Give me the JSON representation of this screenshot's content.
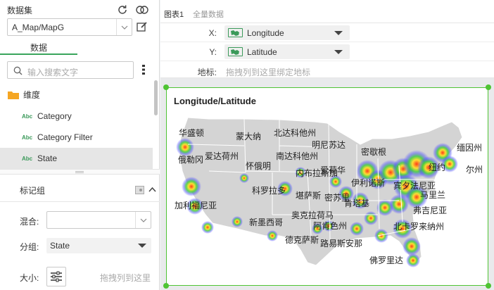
{
  "left_panel": {
    "dataset_title": "数据集",
    "dataset_value": "A_Map/MapG",
    "tab_data": "数据",
    "search_placeholder": "输入搜索文字",
    "folder_label": "维度",
    "fields": [
      {
        "type": "Abc",
        "label": "Category"
      },
      {
        "type": "Abc",
        "label": "Category Filter"
      },
      {
        "type": "Abc",
        "label": "State"
      }
    ],
    "marks_title": "标记组",
    "mix_label": "混合:",
    "mix_value": "",
    "group_label": "分组:",
    "group_value": "State",
    "size_label": "大小:",
    "size_drop_placeholder": "拖拽列到这里"
  },
  "right_panel": {
    "tab_chart": "图表1",
    "tab_full": "全量数据",
    "x_label": "X:",
    "x_field": "Longitude",
    "y_label": "Y:",
    "y_field": "Latitude",
    "geo_label": "地标:",
    "geo_placeholder": "拖拽列到这里绑定地标"
  },
  "chart_data": {
    "type": "heatmap",
    "title": "Longitude/Latitude",
    "state_labels": [
      "华盛顿",
      "蒙大纳",
      "北达科他州",
      "明尼苏达",
      "俄勒冈",
      "爱达荷州",
      "南达科他州",
      "密歇根",
      "缅因州",
      "怀俄明",
      "内布拉斯加",
      "爱荷华",
      "伊利诺斯",
      "纽约",
      "尔州",
      "加利福尼亚",
      "科罗拉多",
      "堪萨斯",
      "密苏里",
      "肯塔基",
      "宾夕法尼亚",
      "马里兰",
      "弗吉尼亚",
      "奥克拉荷马",
      "新墨西哥",
      "阿肯色州",
      "北卡罗来纳州",
      "德克萨斯",
      "路易斯安那",
      "佛罗里达"
    ],
    "colors": {
      "low": "#4b4cff",
      "mid": "#3fcf3a",
      "high": "#ff3a1a",
      "land": "#d4d4d4",
      "border": "#ffffff"
    }
  }
}
